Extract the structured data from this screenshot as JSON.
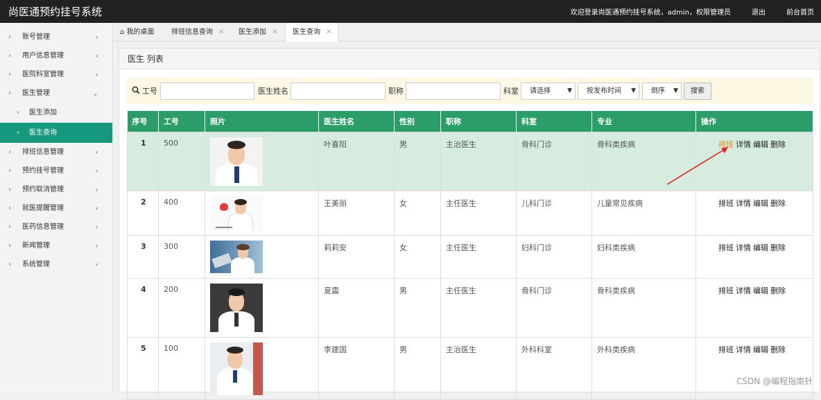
{
  "header": {
    "title": "尚医通预约挂号系统",
    "welcome": "欢迎登录尚医通预约挂号系统，admin，权限管理员",
    "logout": "退出",
    "home": "前台首页"
  },
  "sidebar": {
    "items": [
      {
        "label": "账号管理"
      },
      {
        "label": "用户信息管理"
      },
      {
        "label": "医院科室管理"
      },
      {
        "label": "医生管理"
      },
      {
        "label": "医生添加"
      },
      {
        "label": "医生查询"
      },
      {
        "label": "排班信息管理"
      },
      {
        "label": "预约挂号管理"
      },
      {
        "label": "预约取消管理"
      },
      {
        "label": "就医提醒管理"
      },
      {
        "label": "医药信息管理"
      },
      {
        "label": "新闻管理"
      },
      {
        "label": "系统管理"
      }
    ]
  },
  "tabs": [
    {
      "label": "我的桌面"
    },
    {
      "label": "排班信息查询"
    },
    {
      "label": "医生添加"
    },
    {
      "label": "医生查询"
    }
  ],
  "panel": {
    "title": "医生 列表"
  },
  "search": {
    "id_label": "工号",
    "name_label": "医生姓名",
    "title_label": "职称",
    "dept_label": "科室",
    "dept_select": "请选择",
    "sort_field": "按发布时间",
    "sort_order": "倒序",
    "button": "搜索"
  },
  "table": {
    "headers": [
      "序号",
      "工号",
      "照片",
      "医生姓名",
      "性别",
      "职称",
      "科室",
      "专业",
      "操作"
    ],
    "rows": [
      {
        "no": "1",
        "id": "500",
        "name": "叶喜阳",
        "gender": "男",
        "title": "主治医生",
        "dept": "骨科门诊",
        "major": "骨科类疾病"
      },
      {
        "no": "2",
        "id": "400",
        "name": "王美丽",
        "gender": "女",
        "title": "主任医生",
        "dept": "儿科门诊",
        "major": "儿童常见疾病"
      },
      {
        "no": "3",
        "id": "300",
        "name": "莉莉安",
        "gender": "女",
        "title": "主任医生",
        "dept": "妇科门诊",
        "major": "妇科类疾病"
      },
      {
        "no": "4",
        "id": "200",
        "name": "夏震",
        "gender": "男",
        "title": "主任医生",
        "dept": "骨科门诊",
        "major": "骨科类疾病"
      },
      {
        "no": "5",
        "id": "100",
        "name": "李建国",
        "gender": "男",
        "title": "主治医生",
        "dept": "外科科室",
        "major": "外科类疾病"
      }
    ],
    "ops": {
      "schedule": "排班",
      "detail": "详情",
      "edit": "编辑",
      "delete": "删除"
    }
  },
  "watermark": "CSDN @编程指南针",
  "colors": {
    "topbar": "#212121",
    "accent": "#16987e",
    "header": "#2a9d68",
    "highlight": "#d5ecdf",
    "orange": "#e68a1a"
  }
}
